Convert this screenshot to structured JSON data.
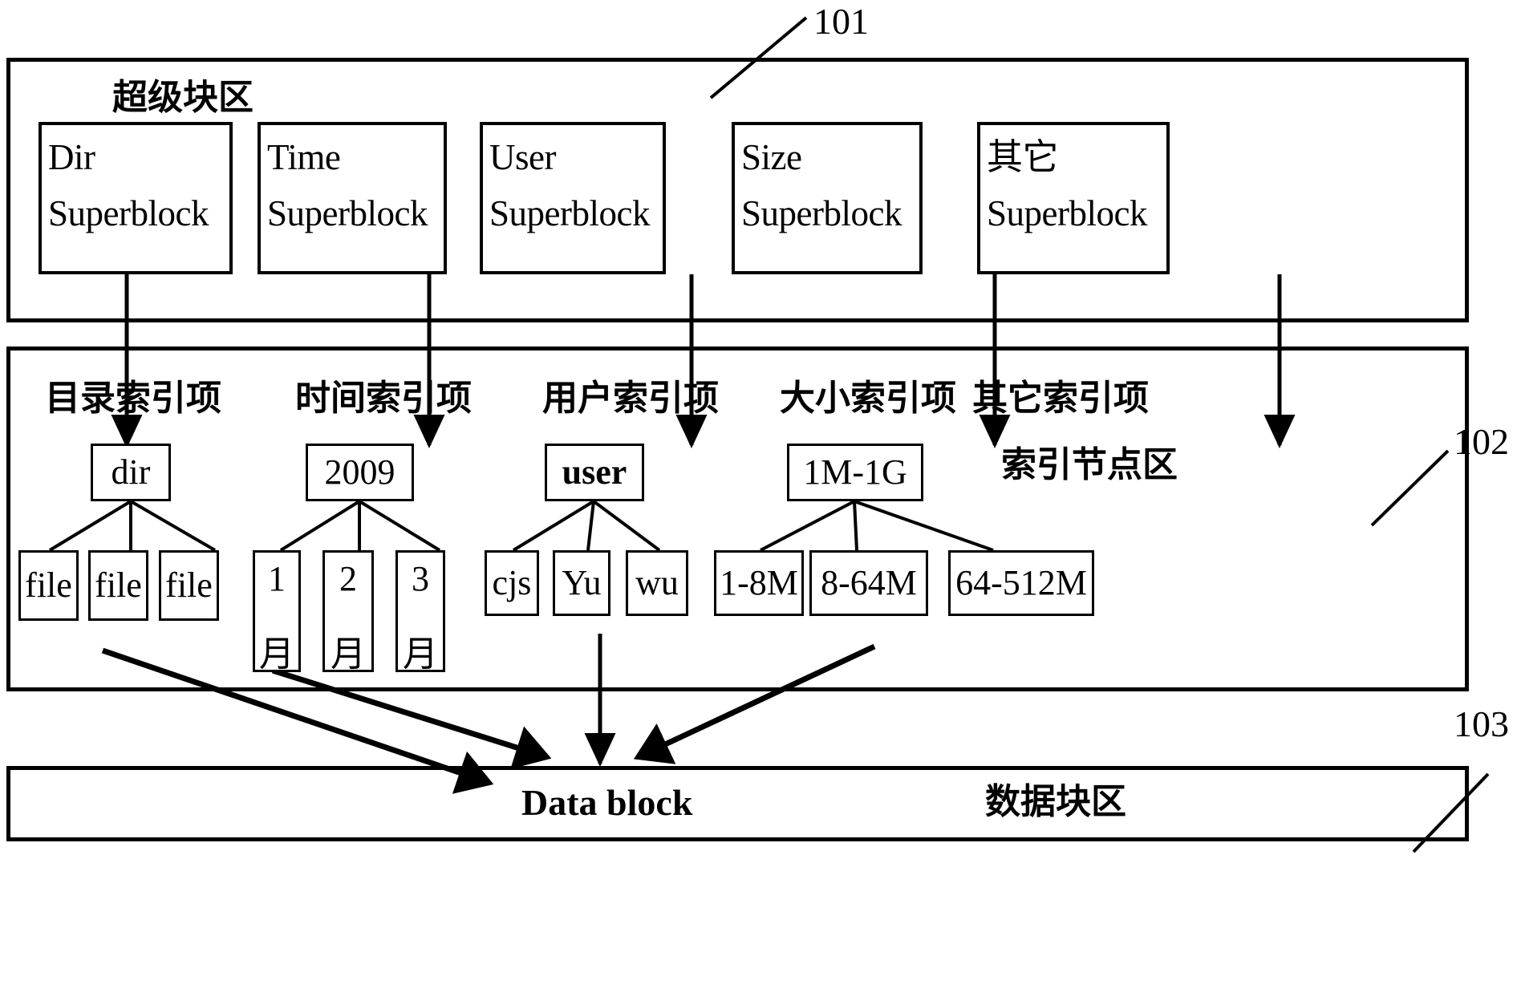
{
  "figure": {
    "title": "File system layout diagram",
    "stroke_color": "#000000",
    "background_color": "#ffffff"
  },
  "regions": [
    {
      "id": "superblock-region",
      "ref": "101",
      "label": "超级块区"
    },
    {
      "id": "inode-region",
      "ref": "102",
      "label": "索引节点区"
    },
    {
      "id": "datablock-region",
      "ref": "103",
      "label": "数据块区"
    }
  ],
  "superblocks": [
    {
      "line1": "Dir",
      "line2": "Superblock"
    },
    {
      "line1": "Time",
      "line2": "Superblock"
    },
    {
      "line1": "User",
      "line2": "Superblock"
    },
    {
      "line1": "Size",
      "line2": "Superblock"
    },
    {
      "line1": "其它",
      "line2": "Superblock"
    }
  ],
  "index_categories": [
    {
      "label": "目录索引项"
    },
    {
      "label": "时间索引项"
    },
    {
      "label": "用户索引项"
    },
    {
      "label": "大小索引项"
    },
    {
      "label": "其它索引项"
    }
  ],
  "trees": [
    {
      "root": "dir",
      "leaves": [
        {
          "line1": "file",
          "line2": ""
        },
        {
          "line1": "file",
          "line2": ""
        },
        {
          "line1": "file",
          "line2": ""
        }
      ]
    },
    {
      "root": "2009",
      "leaves": [
        {
          "line1": "1",
          "line2": "月"
        },
        {
          "line1": "2",
          "line2": "月"
        },
        {
          "line1": "3",
          "line2": "月"
        }
      ]
    },
    {
      "root": "user",
      "leaves": [
        {
          "line1": "cjs",
          "line2": ""
        },
        {
          "line1": "Yu",
          "line2": ""
        },
        {
          "line1": "wu",
          "line2": ""
        }
      ]
    },
    {
      "root": "1M-1G",
      "leaves": [
        {
          "line1": "1-8M",
          "line2": ""
        },
        {
          "line1": "8-64M",
          "line2": ""
        },
        {
          "line1": "64-512M",
          "line2": ""
        }
      ]
    }
  ],
  "data_block": {
    "label": "Data block"
  }
}
